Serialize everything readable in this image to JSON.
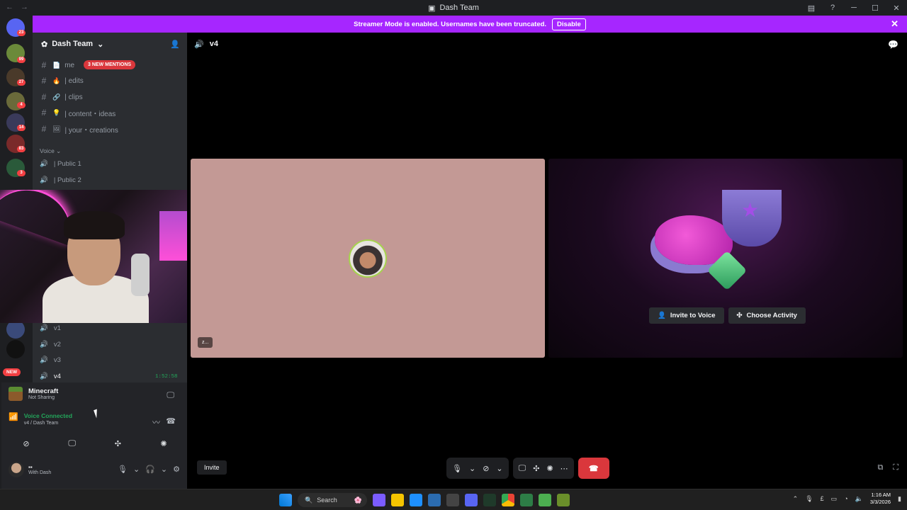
{
  "window": {
    "title": "Dash Team"
  },
  "banner": {
    "text": "Streamer Mode is enabled. Usernames have been truncated.",
    "button": "Disable",
    "color": "#a626ff"
  },
  "rail": {
    "badges": [
      "23",
      "99",
      "27",
      "4",
      "14",
      "83",
      "3"
    ],
    "new_label": "NEW"
  },
  "guild": {
    "name": "Dash Team"
  },
  "text_channels": [
    {
      "name": "me",
      "emoji": "📄"
    },
    {
      "name": "| edits",
      "emoji": "🔥"
    },
    {
      "name": "| clips",
      "emoji": "🔗"
    },
    {
      "name": "| content・ideas",
      "emoji": "💡"
    },
    {
      "name": "| your・creations",
      "emoji": "🖼"
    }
  ],
  "mentions_pill": "3 NEW MENTIONS",
  "voice_category": "Voice",
  "voice_channels_top": [
    "| Public 1",
    "| Public 2"
  ],
  "voice_channels_bottom": [
    "v1",
    "v2",
    "v3",
    "v4"
  ],
  "voice_timer": "1:52:58",
  "activity": {
    "title": "Minecraft",
    "subtitle": "Not Sharing"
  },
  "voice_connection": {
    "status": "Voice Connected",
    "location": "v4 / Dash Team"
  },
  "user": {
    "status_text": "With Dash"
  },
  "stage": {
    "channel": "v4"
  },
  "tile_left": {
    "label": "z..."
  },
  "tile_right": {
    "invite_label": "Invite to Voice",
    "activity_label": "Choose Activity"
  },
  "invite_button": "Invite",
  "taskbar": {
    "search_placeholder": "Search",
    "time": "1:16 AM",
    "date": "3/3/2026"
  }
}
